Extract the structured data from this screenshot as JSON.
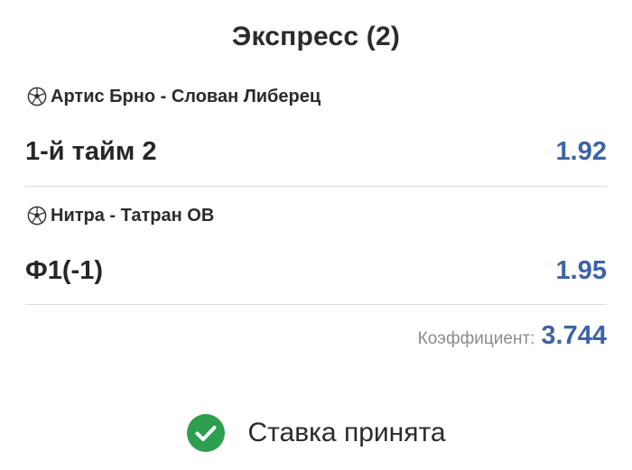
{
  "header": {
    "title": "Экспресс (2)"
  },
  "events": [
    {
      "match": "Артис Брно - Слован Либерец",
      "bet": "1-й тайм 2",
      "odd": "1.92",
      "icon": "soccer-ball-icon"
    },
    {
      "match": "Нитра - Татран ОВ",
      "bet": "Ф1(-1)",
      "odd": "1.95",
      "icon": "soccer-ball-icon"
    }
  ],
  "summary": {
    "coefficient_label": "Коэффициент:",
    "coefficient_value": "3.744"
  },
  "status": {
    "text": "Ставка принята",
    "icon": "check-circle-icon",
    "color": "#2e9e4f"
  },
  "colors": {
    "accent": "#3d63a6",
    "muted": "#8c8c8c",
    "divider": "#dcdcdc"
  }
}
